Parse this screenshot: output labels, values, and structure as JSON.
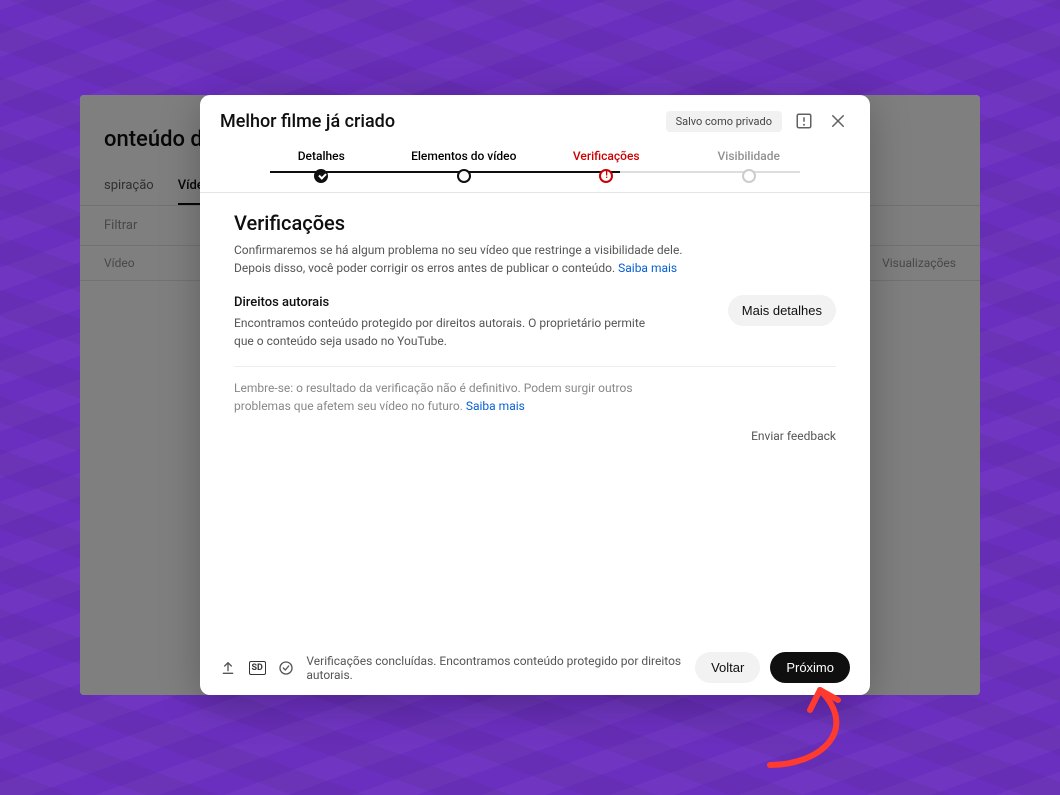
{
  "studio": {
    "title": "onteúdo do canal",
    "tabs": [
      "spiração",
      "Vídeos"
    ],
    "active_tab_index": 1,
    "filter_label": "Filtrar",
    "col_left": "Vídeo",
    "col_right": "Visualizações"
  },
  "dialog": {
    "title": "Melhor filme já criado",
    "save_status": "Salvo como privado",
    "steps": [
      {
        "label": "Detalhes",
        "state": "done"
      },
      {
        "label": "Elementos do vídeo",
        "state": "pending"
      },
      {
        "label": "Verificações",
        "state": "active"
      },
      {
        "label": "Visibilidade",
        "state": "disabled"
      }
    ],
    "section_title": "Verificações",
    "section_desc": "Confirmaremos se há algum problema no seu vídeo que restringe a visibilidade dele. Depois disso, você poder corrigir os erros antes de publicar o conteúdo.",
    "learn_more": "Saiba mais",
    "copyright": {
      "title": "Direitos autorais",
      "desc": "Encontramos conteúdo protegido por direitos autorais. O proprietário permite que o conteúdo seja usado no YouTube.",
      "more": "Mais detalhes"
    },
    "note": "Lembre-se: o resultado da verificação não é definitivo. Podem surgir outros problemas que afetem seu vídeo no futuro.",
    "feedback": "Enviar feedback",
    "footer_status": "Verificações concluídas. Encontramos conteúdo protegido por direitos autorais.",
    "sd_label": "SD",
    "back": "Voltar",
    "next": "Próximo"
  }
}
